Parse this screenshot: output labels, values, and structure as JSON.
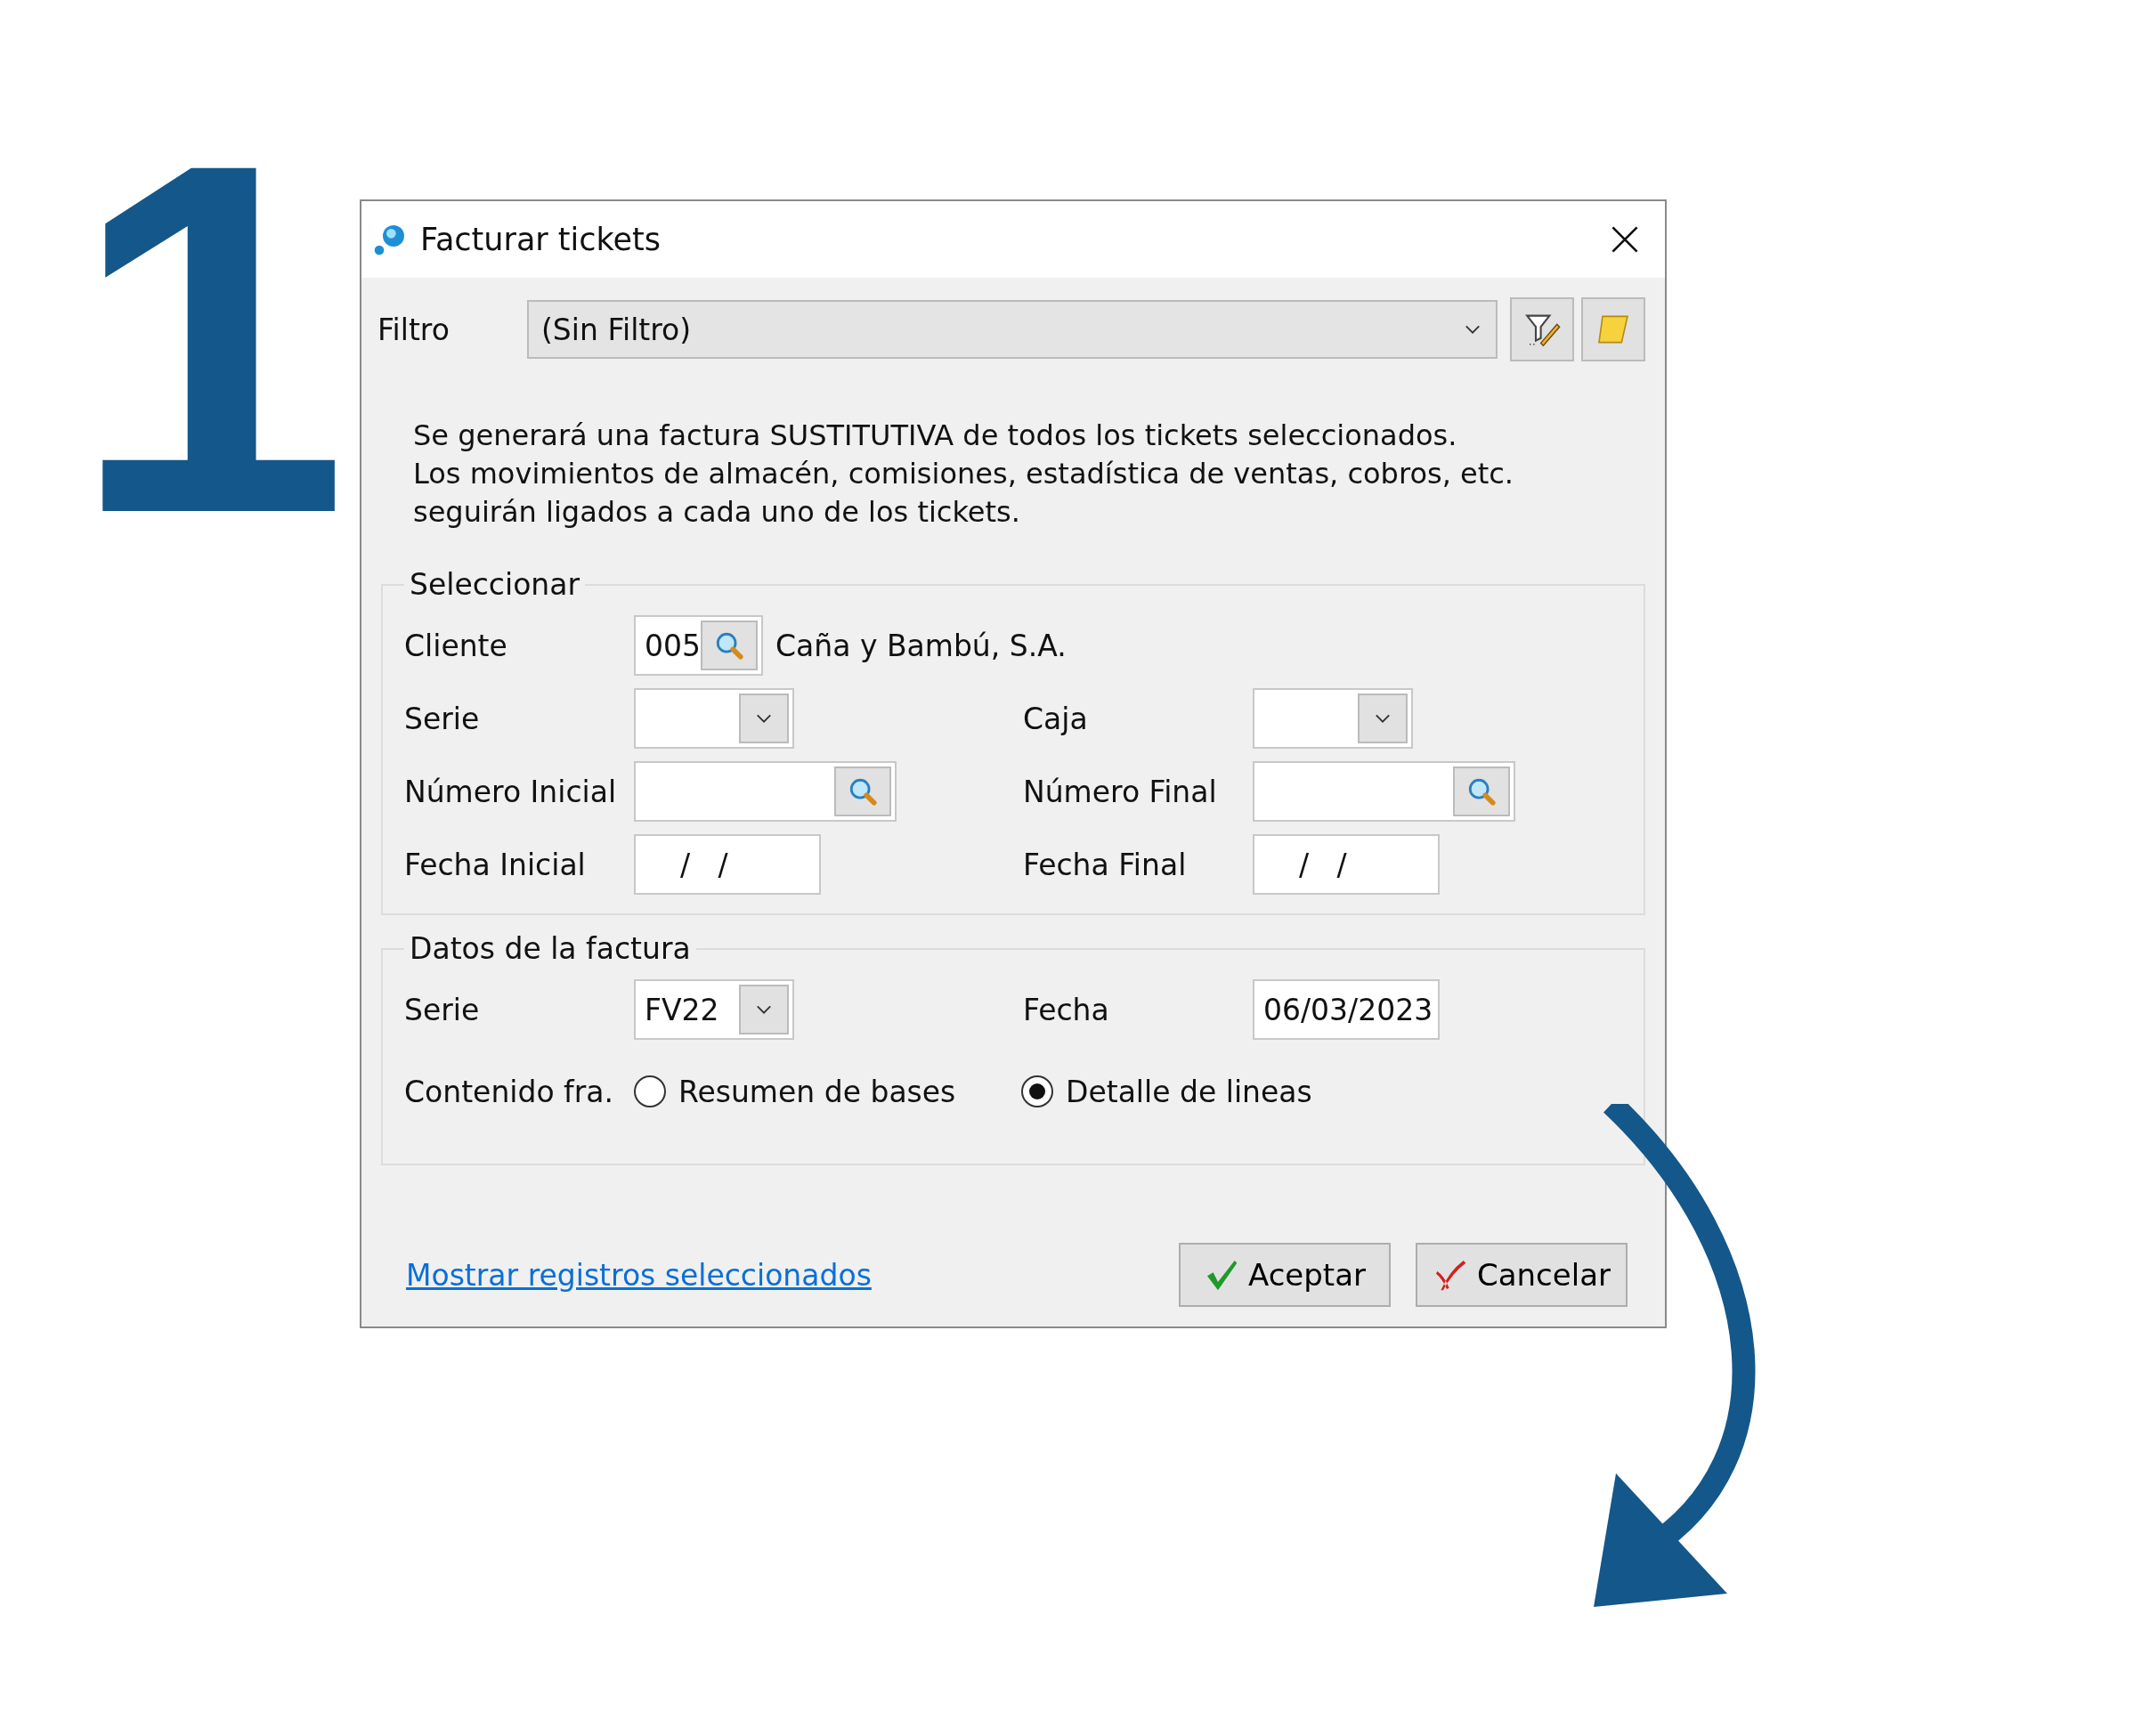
{
  "step_number": "1",
  "window": {
    "title": "Facturar tickets"
  },
  "filter": {
    "label": "Filtro",
    "value": "(Sin Filtro)"
  },
  "description": "Se generará una factura SUSTITUTIVA de todos los tickets seleccionados.\nLos movimientos de almacén, comisiones, estadística de ventas, cobros, etc.\nseguirán ligados a cada uno de los tickets.",
  "select_group": {
    "title": "Seleccionar",
    "rows": [
      {
        "left": {
          "label": "Cliente",
          "kind": "lookup",
          "value": "005",
          "detail": "Caña y Bambú, S.A."
        }
      },
      {
        "left": {
          "label": "Serie",
          "kind": "combo"
        },
        "right": {
          "label": "Caja",
          "kind": "combo"
        }
      },
      {
        "left": {
          "label": "Número Inicial",
          "kind": "lookup"
        },
        "right": {
          "label": "Número Final",
          "kind": "lookup"
        }
      },
      {
        "left": {
          "label": "Fecha Inicial",
          "kind": "date",
          "value": "/   /"
        },
        "right": {
          "label": "Fecha Final",
          "kind": "date",
          "value": "/   /"
        }
      }
    ]
  },
  "invoice_group": {
    "title": "Datos de la factura",
    "rows": [
      {
        "left": {
          "label": "Serie",
          "kind": "combo",
          "value": "FV22"
        },
        "right": {
          "label": "Fecha",
          "kind": "text",
          "value": "06/03/2023"
        }
      }
    ],
    "content": {
      "label": "Contenido fra.",
      "options": [
        {
          "label": "Resumen de bases",
          "selected": false
        },
        {
          "label": "Detalle de lineas",
          "selected": true
        }
      ]
    }
  },
  "link": "Mostrar registros seleccionados",
  "buttons": [
    {
      "label": "Aceptar",
      "kind": "accept"
    },
    {
      "label": "Cancelar",
      "kind": "cancel"
    }
  ]
}
